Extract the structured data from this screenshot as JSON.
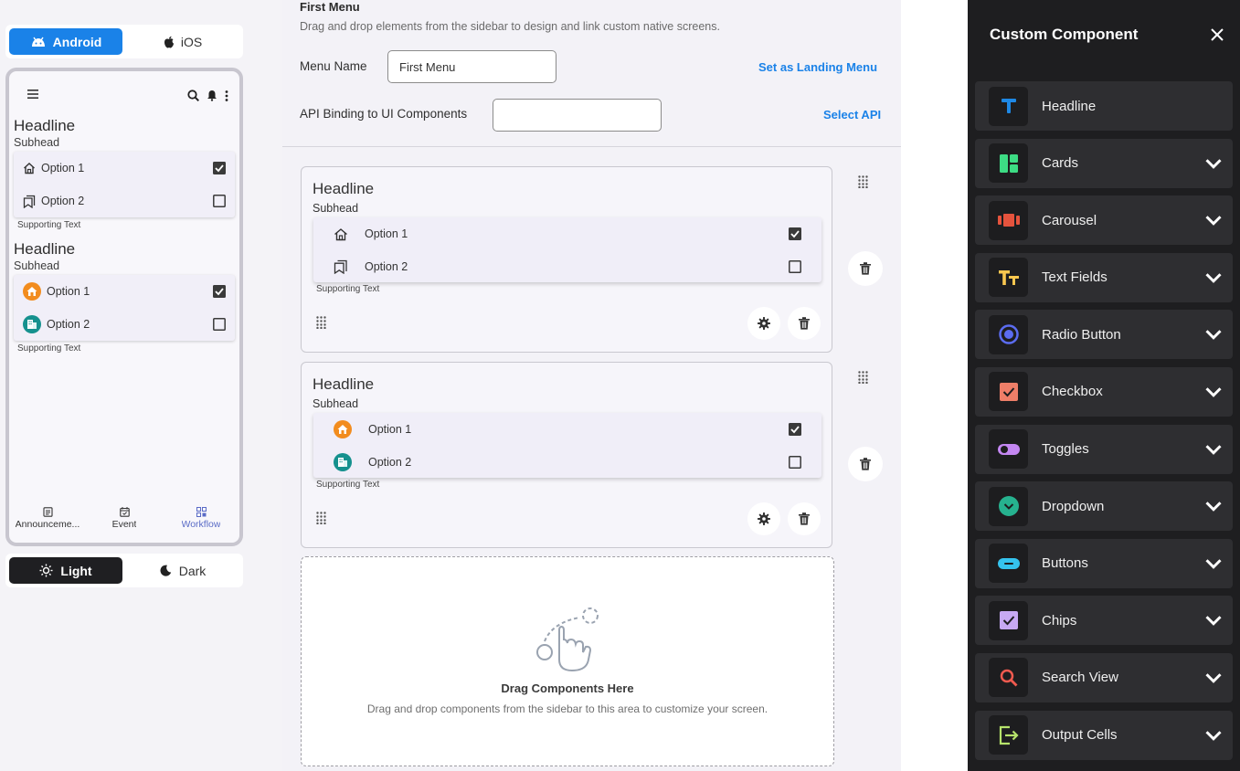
{
  "preview": {
    "os_tabs": [
      {
        "label": "Android"
      },
      {
        "label": "iOS"
      }
    ],
    "cards": [
      {
        "headline": "Headline",
        "subhead": "Subhead",
        "options": [
          {
            "label": "Option 1",
            "checked": true
          },
          {
            "label": "Option 2",
            "checked": false
          }
        ],
        "supporting": "Supporting Text"
      },
      {
        "headline": "Headline",
        "subhead": "Subhead",
        "options": [
          {
            "label": "Option 1",
            "checked": true
          },
          {
            "label": "Option 2",
            "checked": false
          }
        ],
        "supporting": "Supporting Text"
      }
    ],
    "bottom_tabs": [
      {
        "label": "Announceme..."
      },
      {
        "label": "Event"
      },
      {
        "label": "Workflow"
      }
    ],
    "theme_tabs": [
      {
        "label": "Light"
      },
      {
        "label": "Dark"
      }
    ]
  },
  "editor": {
    "title": "First Menu",
    "description": "Drag and drop elements from the sidebar to design and link custom native screens.",
    "menu_name_label": "Menu Name",
    "menu_name_value": "First Menu",
    "set_landing_label": "Set as Landing Menu",
    "api_binding_label": "API Binding to UI Components",
    "api_binding_value": "",
    "select_api_label": "Select API",
    "cards": [
      {
        "headline": "Headline",
        "subhead": "Subhead",
        "options": [
          {
            "label": "Option 1",
            "checked": true
          },
          {
            "label": "Option 2",
            "checked": false
          }
        ],
        "supporting": "Supporting Text"
      },
      {
        "headline": "Headline",
        "subhead": "Subhead",
        "options": [
          {
            "label": "Option 1",
            "checked": true
          },
          {
            "label": "Option 2",
            "checked": false
          }
        ],
        "supporting": "Supporting Text"
      }
    ],
    "dropzone": {
      "title": "Drag Components Here",
      "description": "Drag and drop components from the sidebar to this area to customize your screen."
    }
  },
  "sidebar": {
    "title": "Custom Component",
    "items": [
      {
        "label": "Headline",
        "icon": "text-t-icon",
        "color": "#1e88e5",
        "expandable": false
      },
      {
        "label": "Cards",
        "icon": "cards-layout-icon",
        "color": "#3ddc84",
        "expandable": true
      },
      {
        "label": "Carousel",
        "icon": "carousel-icon",
        "color": "#e5533d",
        "expandable": true
      },
      {
        "label": "Text Fields",
        "icon": "text-fields-icon",
        "color": "#f9c74f",
        "expandable": true
      },
      {
        "label": "Radio Button",
        "icon": "radio-button-icon",
        "color": "#5b6cf0",
        "expandable": true
      },
      {
        "label": "Checkbox",
        "icon": "checkbox-icon",
        "color": "#ee7e68",
        "expandable": true
      },
      {
        "label": "Toggles",
        "icon": "toggle-icon",
        "color": "#c487f2",
        "expandable": true
      },
      {
        "label": "Dropdown",
        "icon": "dropdown-icon",
        "color": "#26b28f",
        "expandable": true
      },
      {
        "label": "Buttons",
        "icon": "buttons-icon",
        "color": "#35c3ee",
        "expandable": true
      },
      {
        "label": "Chips",
        "icon": "chips-icon",
        "color": "#c7a9f3",
        "expandable": true
      },
      {
        "label": "Search View",
        "icon": "search-icon",
        "color": "#f05a4f",
        "expandable": true
      },
      {
        "label": "Output Cells",
        "icon": "output-cells-icon",
        "color": "#b6e36b",
        "expandable": true
      }
    ]
  }
}
